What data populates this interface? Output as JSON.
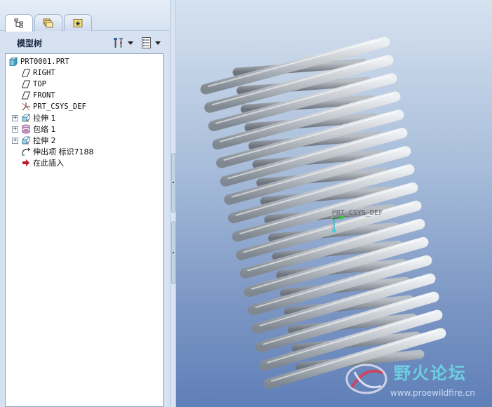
{
  "tabs": [
    {
      "name": "model-tree-tab",
      "icon": "tree-structure-icon"
    },
    {
      "name": "folder-browser-tab",
      "icon": "folders-icon"
    },
    {
      "name": "favorites-tab",
      "icon": "star-icon"
    }
  ],
  "panel": {
    "title": "模型树",
    "settings_icon": "tools-icon",
    "show_icon": "list-icon"
  },
  "tree": [
    {
      "label": "PRT0001.PRT",
      "icon": "part-icon",
      "expander": null
    },
    {
      "label": "RIGHT",
      "icon": "datum-plane-icon",
      "expander": null
    },
    {
      "label": "TOP",
      "icon": "datum-plane-icon",
      "expander": null
    },
    {
      "label": "FRONT",
      "icon": "datum-plane-icon",
      "expander": null
    },
    {
      "label": "PRT_CSYS_DEF",
      "icon": "csys-icon",
      "expander": null
    },
    {
      "label": "拉伸 1",
      "icon": "extrude-icon",
      "expander": "+"
    },
    {
      "label": "包络 1",
      "icon": "wrap-icon",
      "expander": "+"
    },
    {
      "label": "拉伸 2",
      "icon": "extrude-icon",
      "expander": "+"
    },
    {
      "label": "伸出项 标识7188",
      "icon": "protrusion-icon",
      "expander": null
    },
    {
      "label": "在此插入",
      "icon": "insert-here-arrow-icon",
      "expander": null
    }
  ],
  "viewport": {
    "csys_label": "PRT_CSYS_DEF",
    "watermark_text": "野火论坛",
    "watermark_url": "www.proewildfire.cn"
  },
  "colors": {
    "background_top": "#d6e2ef",
    "background_bottom": "#5f7fb8",
    "model": "#b9c0c8",
    "watermark": "#6edce6"
  }
}
